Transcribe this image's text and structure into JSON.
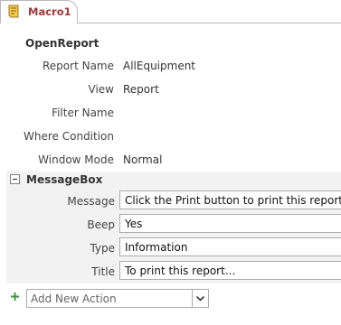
{
  "tab": {
    "title": "Macro1",
    "icon": "macro-icon"
  },
  "open_report": {
    "action_name": "OpenReport",
    "arguments": [
      {
        "label": "Report Name",
        "value": "AllEquipment"
      },
      {
        "label": "View",
        "value": "Report"
      },
      {
        "label": "Filter Name",
        "value": ""
      },
      {
        "label": "Where Condition",
        "value": ""
      },
      {
        "label": "Window Mode",
        "value": "Normal"
      }
    ]
  },
  "message_box": {
    "action_name": "MessageBox",
    "collapse_icon": "collapse-minus-icon",
    "arguments": [
      {
        "label": "Message",
        "value": "Click the Print button to print this report"
      },
      {
        "label": "Beep",
        "value": "Yes"
      },
      {
        "label": "Type",
        "value": "Information"
      },
      {
        "label": "Title",
        "value": "To print this report..."
      }
    ]
  },
  "add_action": {
    "placeholder": "Add New Action",
    "icon": "add-plus-icon",
    "dropdown_icon": "chevron-down-icon"
  },
  "colors": {
    "tab_text": "#a4373a",
    "block_background": "#f2f2f2",
    "plus_green": "#3f9a3f"
  }
}
